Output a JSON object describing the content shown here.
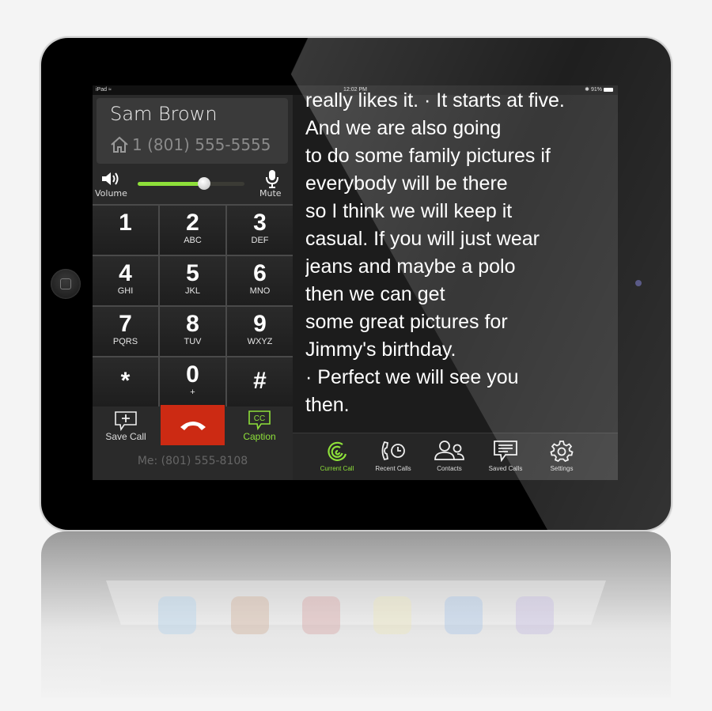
{
  "status_bar": {
    "device": "iPad",
    "time": "12:02 PM",
    "battery": "91%"
  },
  "contact": {
    "name": "Sam Brown",
    "phone": "1 (801) 555-5555",
    "phone_icon": "home-icon"
  },
  "volume": {
    "label": "Volume",
    "mute_label": "Mute",
    "level_percent": 62
  },
  "keypad": [
    {
      "digit": "1",
      "letters": ""
    },
    {
      "digit": "2",
      "letters": "ABC"
    },
    {
      "digit": "3",
      "letters": "DEF"
    },
    {
      "digit": "4",
      "letters": "GHI"
    },
    {
      "digit": "5",
      "letters": "JKL"
    },
    {
      "digit": "6",
      "letters": "MNO"
    },
    {
      "digit": "7",
      "letters": "PQRS"
    },
    {
      "digit": "8",
      "letters": "TUV"
    },
    {
      "digit": "9",
      "letters": "WXYZ"
    },
    {
      "digit": "*",
      "letters": ""
    },
    {
      "digit": "0",
      "letters": "+"
    },
    {
      "digit": "#",
      "letters": ""
    }
  ],
  "actions": {
    "save_call": "Save Call",
    "caption": "Caption",
    "caption_icon_text": "CC"
  },
  "me": "Me: (801) 555-8108",
  "caption_lines": [
    "really likes it. · It starts at five.",
    "And we are also going",
    "to do some family pictures if",
    "everybody will be there",
    "so I think we will keep it",
    "casual. If you will just wear",
    "jeans and maybe a polo",
    "then we can get",
    "some great pictures  for",
    "Jimmy's birthday.",
    " · Perfect we will see you",
    "then."
  ],
  "tabs": [
    {
      "label": "Current Call",
      "icon": "current-call-icon",
      "active": true
    },
    {
      "label": "Recent Calls",
      "icon": "recent-calls-icon",
      "active": false
    },
    {
      "label": "Contacts",
      "icon": "contacts-icon",
      "active": false
    },
    {
      "label": "Saved Calls",
      "icon": "saved-calls-icon",
      "active": false
    },
    {
      "label": "Settings",
      "icon": "gear-icon",
      "active": false
    }
  ],
  "colors": {
    "accent_green": "#8ee03a",
    "end_call_red": "#cc2a13"
  }
}
